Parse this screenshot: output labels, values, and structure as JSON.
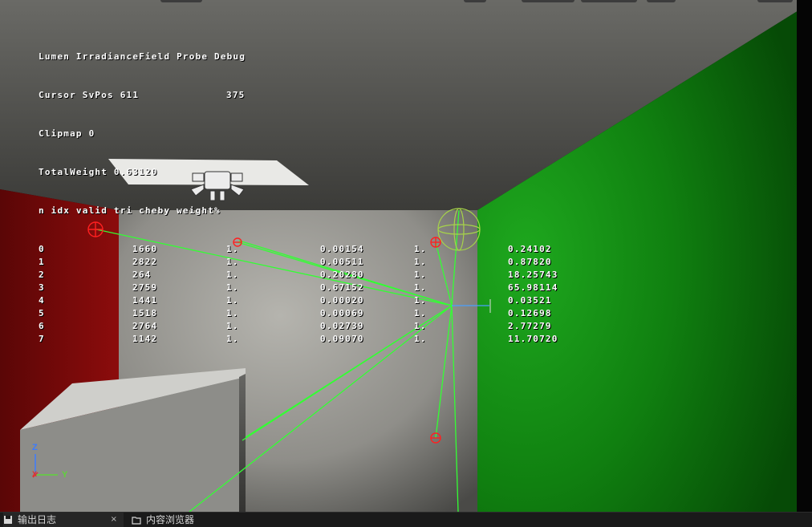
{
  "debug": {
    "title": "Lumen IrradianceField Probe Debug",
    "cursor_label": "Cursor SvPos 611",
    "cursor_y": "375",
    "clipmap": "Clipmap 0",
    "total_weight": "TotalWeight 0.63120",
    "header": "n idx valid tri cheby weight%",
    "rows": [
      [
        "0",
        "1660",
        "1.",
        "0.00154",
        "1.",
        "0.24102"
      ],
      [
        "1",
        "2822",
        "1.",
        "0.00511",
        "1.",
        "0.87820"
      ],
      [
        "2",
        "264",
        "1.",
        "0.20280",
        "1.",
        "18.25743"
      ],
      [
        "3",
        "2759",
        "1.",
        "0.67152",
        "1.",
        "65.98114"
      ],
      [
        "4",
        "1441",
        "1.",
        "0.00020",
        "1.",
        "0.03521"
      ],
      [
        "5",
        "1518",
        "1.",
        "0.00069",
        "1.",
        "0.12698"
      ],
      [
        "6",
        "2764",
        "1.",
        "0.02739",
        "1.",
        "2.77279"
      ],
      [
        "7",
        "1142",
        "1.",
        "0.09070",
        "1.",
        "11.70720"
      ]
    ]
  },
  "axis": {
    "z_label": "Z",
    "x_label": "X",
    "y_label": "Y"
  },
  "bottom_bar": {
    "output_log_label": "输出日志",
    "close_glyph": "×",
    "content_browser_label": "内容浏览器"
  },
  "colors": {
    "left_wall": "#7a0a0a",
    "right_wall": "#138a13",
    "back_wall": "#8c8b87",
    "ceiling": "#3a3a37",
    "probe_red": "#ff2020",
    "ray_green": "#33ff33"
  },
  "icons": {
    "light": "spot-light-icon",
    "probe": "probe-marker-icon",
    "sphere": "sphere-gizmo-icon"
  }
}
